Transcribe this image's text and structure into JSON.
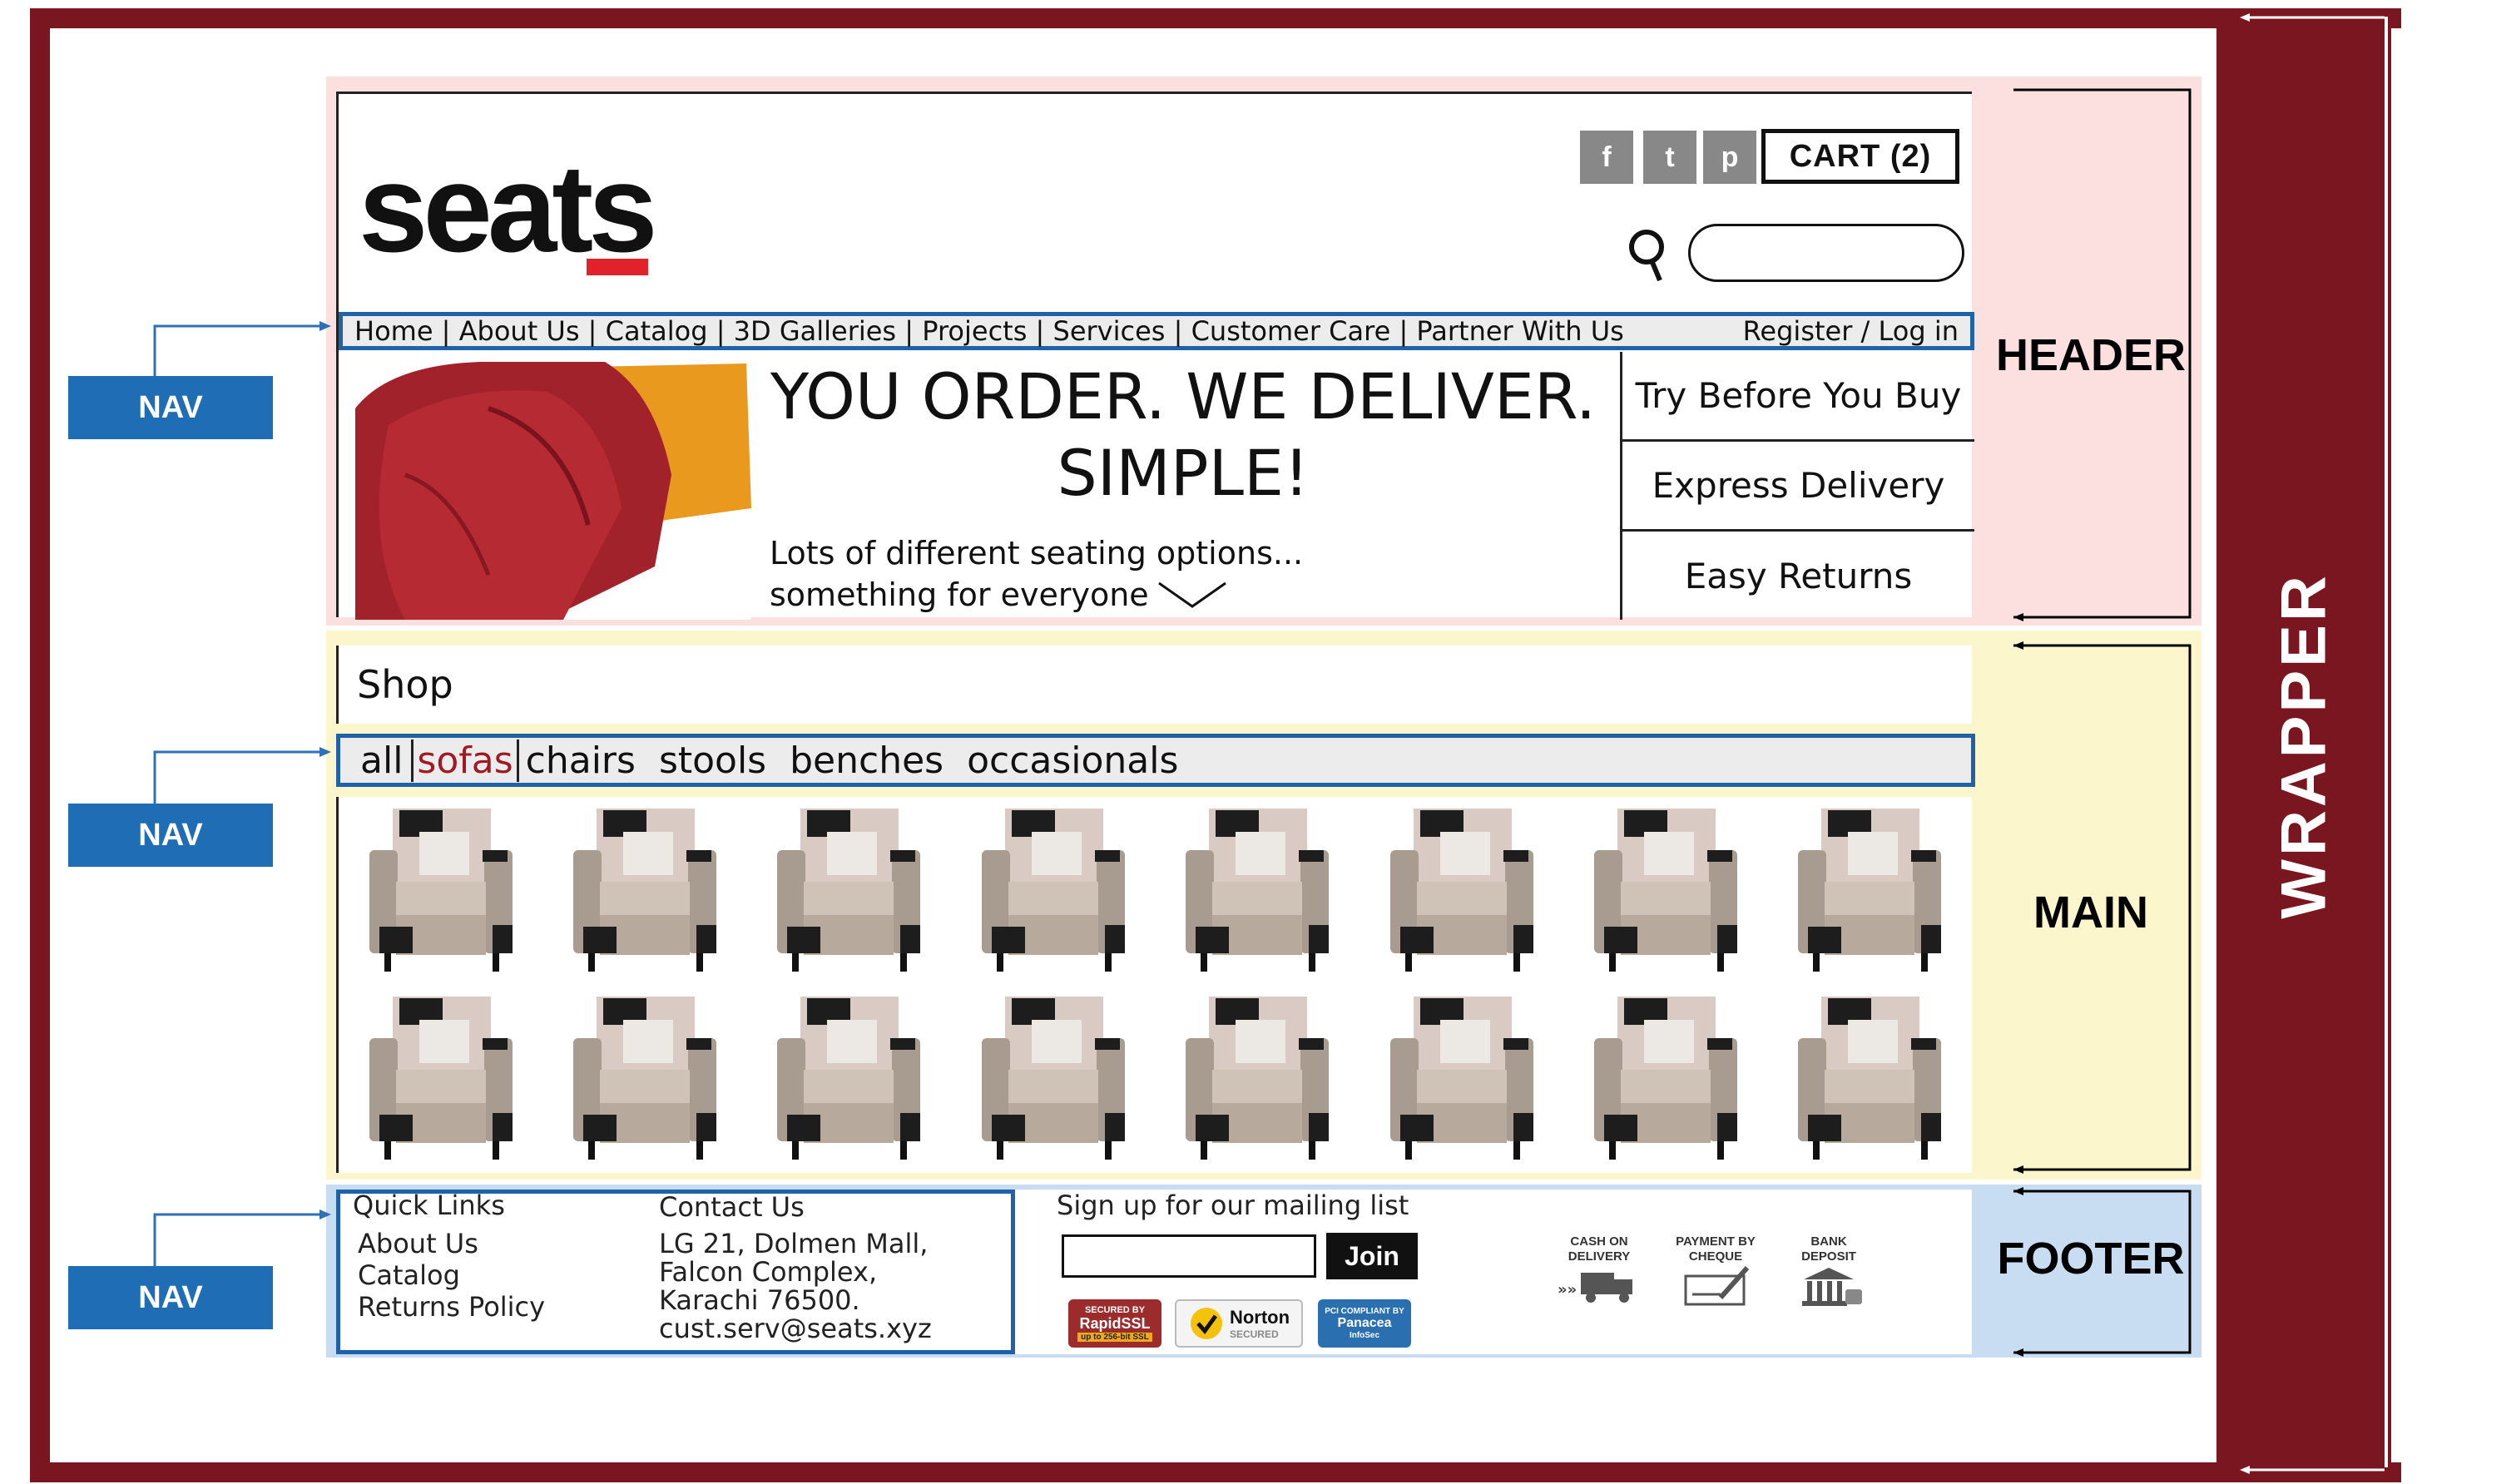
{
  "labels": {
    "wrapper": "WRAPPER",
    "header": "HEADER",
    "main": "MAIN",
    "footer": "FOOTER",
    "nav": "NAV"
  },
  "colors": {
    "wrapper": "#7a1620",
    "header_bg": "#fce0e0",
    "main_bg": "#fbf6cc",
    "footer_bg": "#c8dcf2",
    "nav_border": "#1f62a8",
    "nav_tag": "#1f6db5",
    "logo_accent": "#e0232b",
    "active_category": "#9e1a24"
  },
  "header": {
    "logo": "seats",
    "social": [
      {
        "icon": "facebook-icon",
        "glyph": "f"
      },
      {
        "icon": "twitter-icon",
        "glyph": "t"
      },
      {
        "icon": "pinterest-icon",
        "glyph": "p"
      }
    ],
    "cart": "CART (2)",
    "nav": {
      "items": [
        "Home",
        "About Us",
        "Catalog",
        "3D Galleries",
        "Projects",
        "Services",
        "Customer Care",
        "Partner With Us"
      ],
      "separator": " | ",
      "account": "Register / Log in"
    },
    "hero": {
      "title_line1": "YOU ORDER. WE DELIVER.",
      "title_line2": "SIMPLE!",
      "subtitle1": "Lots of different seating options...",
      "subtitle2": "something for everyone"
    },
    "features": [
      "Try Before You Buy",
      "Express Delivery",
      "Easy Returns"
    ]
  },
  "main": {
    "title": "Shop",
    "categories": [
      "all",
      "sofas",
      "chairs",
      "stools",
      "benches",
      "occasionals"
    ],
    "active_category": "sofas",
    "product_rows": 2,
    "product_cols": 8
  },
  "footer": {
    "quick_links_title": "Quick Links",
    "quick_links": [
      "About Us",
      "Catalog",
      "Returns Policy"
    ],
    "contact_title": "Contact Us",
    "contact_lines": [
      "LG 21, Dolmen Mall,",
      "Falcon Complex,",
      "Karachi 76500.",
      "cust.serv@seats.xyz"
    ],
    "mailing_title": "Sign up for our mailing list",
    "join": "Join",
    "badges": {
      "rapidssl_top": "SECURED BY",
      "rapidssl": "RapidSSL",
      "rapidssl_bottom": "up to 256-bit SSL",
      "norton": "Norton",
      "norton_sub": "SECURED",
      "panacea_top": "PCI COMPLIANT BY",
      "panacea": "Panacea",
      "panacea_sub": "InfoSec"
    },
    "payments": [
      {
        "line1": "CASH ON",
        "line2": "DELIVERY"
      },
      {
        "line1": "PAYMENT BY",
        "line2": "CHEQUE"
      },
      {
        "line1": "BANK",
        "line2": "DEPOSIT"
      }
    ]
  }
}
